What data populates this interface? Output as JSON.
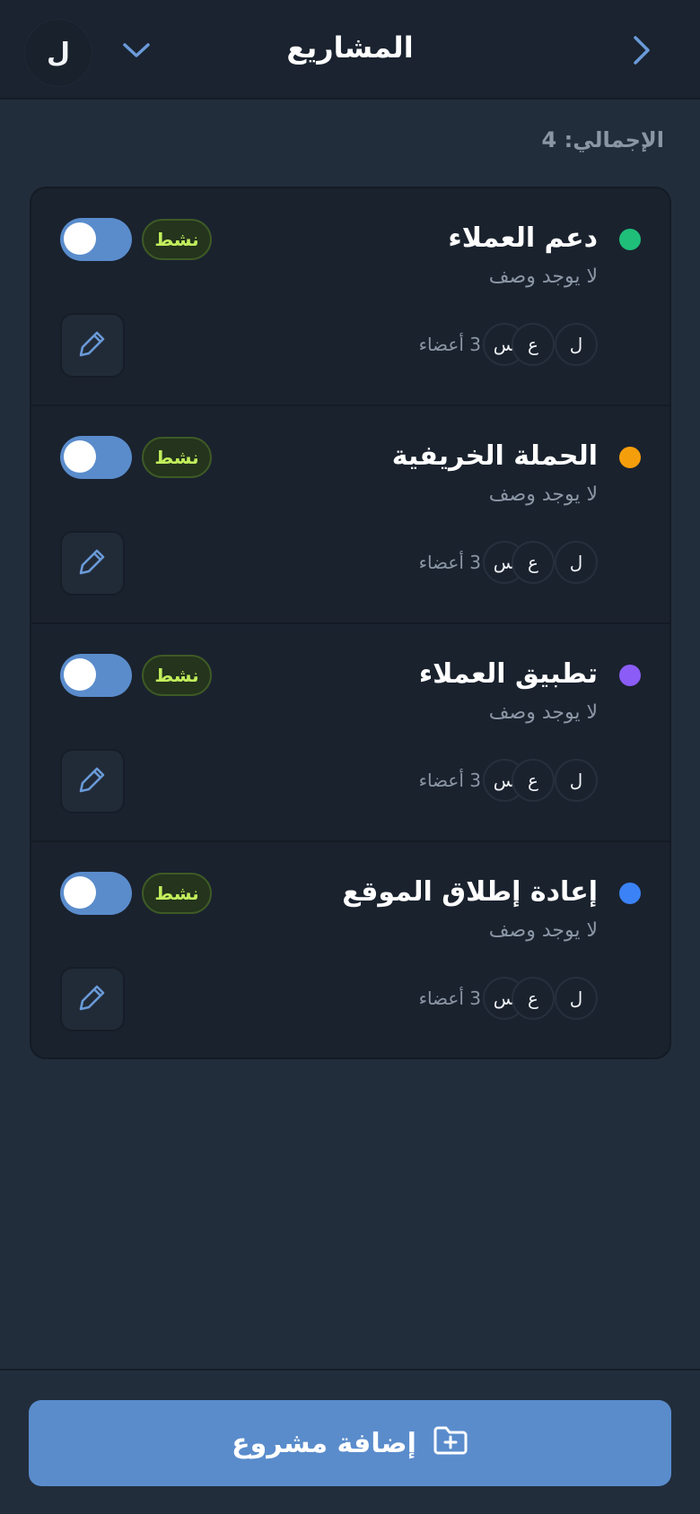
{
  "header": {
    "title": "المشاريع",
    "avatar_initial": "ل"
  },
  "summary": {
    "total_label": "الإجمالي: 4"
  },
  "colors": {
    "accent": "#5a8ccc",
    "badge_text": "#c2ee5c",
    "pencil": "#6a9ad8"
  },
  "projects": [
    {
      "name": "دعم العملاء",
      "description": "لا يوجد وصف",
      "status": "نشط",
      "active": true,
      "color": "#1fbf7a",
      "members": [
        "ل",
        "ع",
        "س"
      ],
      "members_count": "3 أعضاء"
    },
    {
      "name": "الحملة الخريفية",
      "description": "لا يوجد وصف",
      "status": "نشط",
      "active": true,
      "color": "#f59e0b",
      "members": [
        "ل",
        "ع",
        "س"
      ],
      "members_count": "3 أعضاء"
    },
    {
      "name": "تطبيق العملاء",
      "description": "لا يوجد وصف",
      "status": "نشط",
      "active": true,
      "color": "#8b5cf6",
      "members": [
        "ل",
        "ع",
        "س"
      ],
      "members_count": "3 أعضاء"
    },
    {
      "name": "إعادة إطلاق الموقع",
      "description": "لا يوجد وصف",
      "status": "نشط",
      "active": true,
      "color": "#3b82f6",
      "members": [
        "ل",
        "ع",
        "س"
      ],
      "members_count": "3 أعضاء"
    }
  ],
  "footer": {
    "add_label": "إضافة مشروع"
  }
}
